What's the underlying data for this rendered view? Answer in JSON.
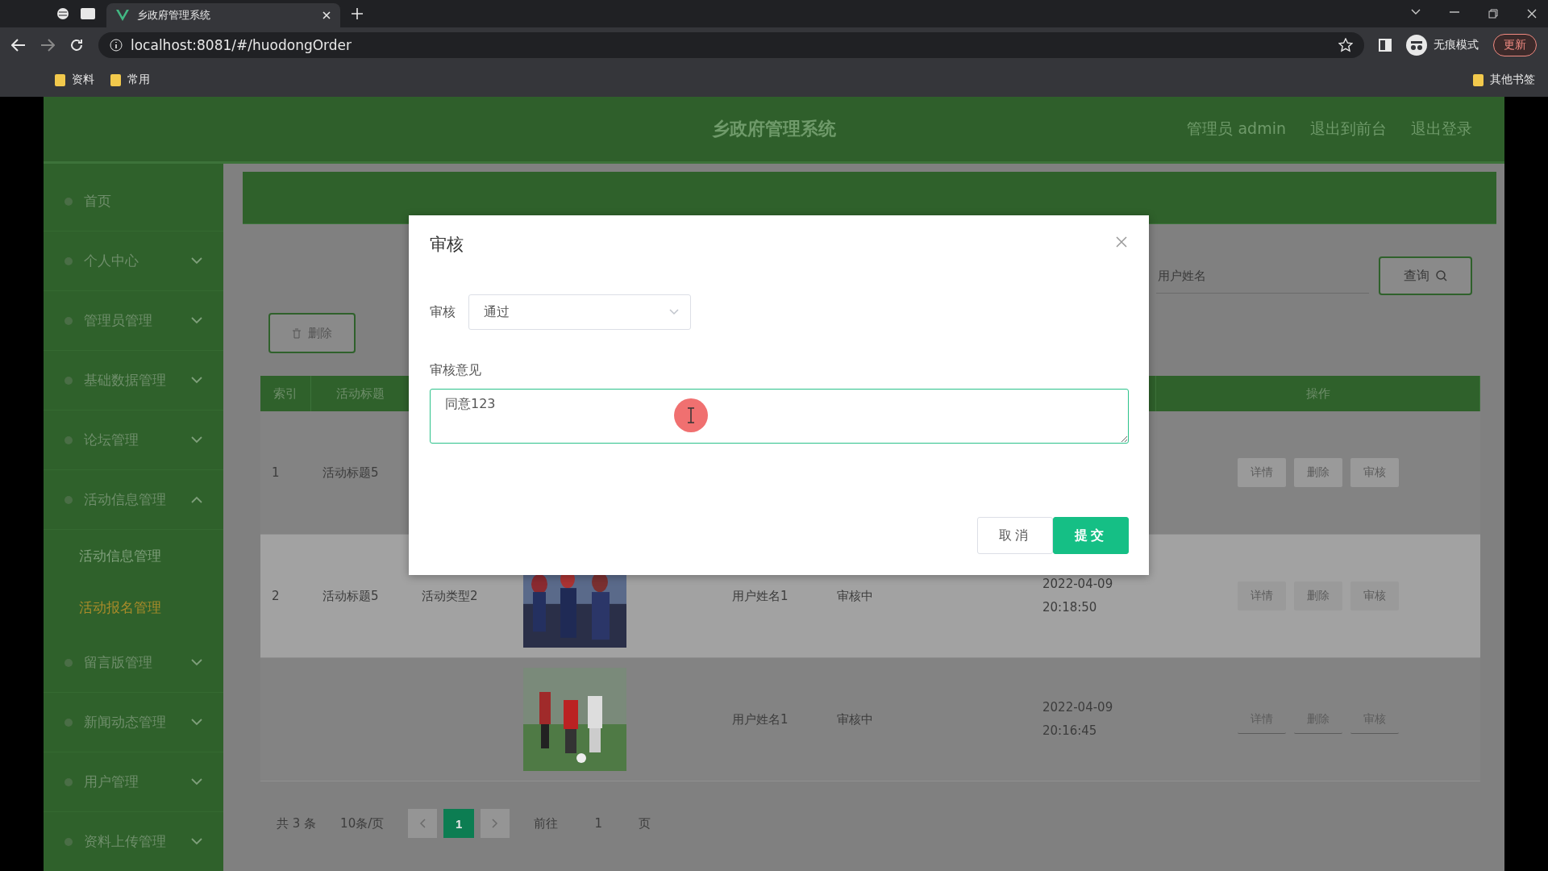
{
  "browser": {
    "tab_title": "乡政府管理系统",
    "url": "localhost:8081/#/huodongOrder",
    "incognito_label": "无痕模式",
    "update_button": "更新",
    "bookmarks": [
      "资料",
      "常用"
    ],
    "other_bookmarks": "其他书签"
  },
  "header": {
    "title": "乡政府管理系统",
    "user": "管理员 admin",
    "links": [
      "退出到前台",
      "退出登录"
    ]
  },
  "sidebar": {
    "items": [
      {
        "label": "首页",
        "kind": "link"
      },
      {
        "label": "个人中心",
        "kind": "group",
        "expanded": false
      },
      {
        "label": "管理员管理",
        "kind": "group",
        "expanded": false
      },
      {
        "label": "基础数据管理",
        "kind": "group",
        "expanded": false
      },
      {
        "label": "论坛管理",
        "kind": "group",
        "expanded": false
      },
      {
        "label": "活动信息管理",
        "kind": "group",
        "expanded": true,
        "children": [
          {
            "label": "活动信息管理",
            "selected": false
          },
          {
            "label": "活动报名管理",
            "selected": true
          }
        ]
      },
      {
        "label": "留言版管理",
        "kind": "group",
        "expanded": false
      },
      {
        "label": "新闻动态管理",
        "kind": "group",
        "expanded": false
      },
      {
        "label": "用户管理",
        "kind": "group",
        "expanded": false
      },
      {
        "label": "资料上传管理",
        "kind": "group",
        "expanded": false
      }
    ]
  },
  "search": {
    "placeholder": "用户姓名",
    "button": "查询"
  },
  "delete_button": "删除",
  "table": {
    "columns": [
      "索引",
      "活动标题",
      "",
      "",
      "",
      "",
      "",
      "",
      "操作"
    ],
    "rows": [
      {
        "cells": [
          "1",
          "活动标题5",
          "",
          "",
          "",
          "",
          "",
          ""
        ],
        "actions": [
          "详情",
          "删除",
          "审核"
        ],
        "hovered": false
      },
      {
        "cells": [
          "2",
          "活动标题5",
          "活动类型2",
          "",
          "",
          "用户姓名1",
          "审核中",
          "2022-04-09\n20:18:50"
        ],
        "picture": true,
        "actions": [
          "详情",
          "删除",
          "审核"
        ],
        "hovered": true
      },
      {
        "cells": [
          "",
          "",
          "",
          "",
          "",
          "用户姓名1",
          "审核中",
          "2022-04-09\n20:16:45"
        ],
        "picture": true,
        "actions": [
          "详情",
          "删除",
          "审核"
        ],
        "hovered": false
      }
    ]
  },
  "pagination": {
    "total": "共 3 条",
    "page_size": "10条/页",
    "pages": [
      {
        "label": "1",
        "selected": true
      }
    ],
    "goto_label": "前往",
    "goto_value": "1",
    "goto_suffix": "页"
  },
  "dialog": {
    "title": "审核",
    "fields": [
      {
        "kind": "select",
        "label": "审核",
        "value": "通过"
      },
      {
        "kind": "textarea",
        "label": "审核意见",
        "value": "同意123"
      }
    ],
    "buttons": [
      {
        "label": "取消",
        "kind": "default"
      },
      {
        "label": "提交",
        "kind": "primary"
      }
    ]
  }
}
